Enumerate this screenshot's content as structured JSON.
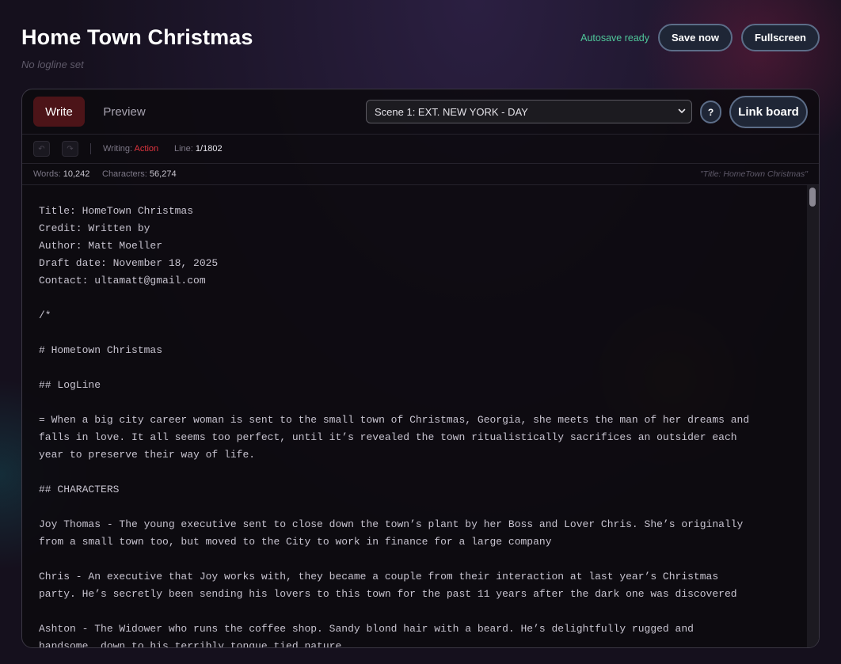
{
  "header": {
    "title": "Home Town Christmas",
    "logline": "No logline set",
    "autosave_status": "Autosave ready",
    "save_label": "Save now",
    "fullscreen_label": "Fullscreen"
  },
  "editor": {
    "tabs": {
      "write": "Write",
      "preview": "Preview"
    },
    "scene_select": {
      "selected": "Scene 1: EXT. NEW YORK - DAY"
    },
    "help_label": "?",
    "link_board_label": "Link board",
    "status": {
      "undo_icon": "undo-icon",
      "redo_icon": "redo-icon",
      "writing_label": "Writing:",
      "writing_value": "Action",
      "line_label": "Line:",
      "line_value": "1/1802"
    },
    "stats": {
      "words_label": "Words:",
      "words_value": "10,242",
      "chars_label": "Characters:",
      "chars_value": "56,274",
      "current_line": "\"Title: HomeTown Christmas\""
    },
    "script_lines": [
      "Title: HomeTown Christmas",
      "Credit: Written by",
      "Author: Matt Moeller",
      "Draft date: November 18, 2025",
      "Contact: ultamatt@gmail.com",
      "",
      "/*",
      "",
      "# Hometown Christmas",
      "",
      "## LogLine",
      "",
      "= When a big city career woman is sent to the small town of Christmas, Georgia, she meets the man of her dreams and",
      "falls in love. It all seems too perfect, until it’s revealed the town ritualistically sacrifices an outsider each",
      "year to preserve their way of life.",
      "",
      "## CHARACTERS",
      "",
      "Joy Thomas - The young executive sent to close down the town’s plant by her Boss and Lover Chris. She’s originally",
      "from a small town too, but moved to the City to work in finance for a large company",
      "",
      "Chris - An executive that Joy works with, they became a couple from their interaction at last year’s Christmas",
      "party. He’s secretly been sending his lovers to this town for the past 11 years after the dark one was discovered",
      "",
      "Ashton - The Widower who runs the coffee shop. Sandy blond hair with a beard. He’s delightfully rugged and",
      "handsome, down to his terribly tongue tied nature"
    ]
  },
  "colors": {
    "background": "#15101d",
    "autosave": "#4fc79a",
    "write_tab": "#4c1418",
    "writing_mode": "#e0343e",
    "button_border": "#5c6d88"
  }
}
